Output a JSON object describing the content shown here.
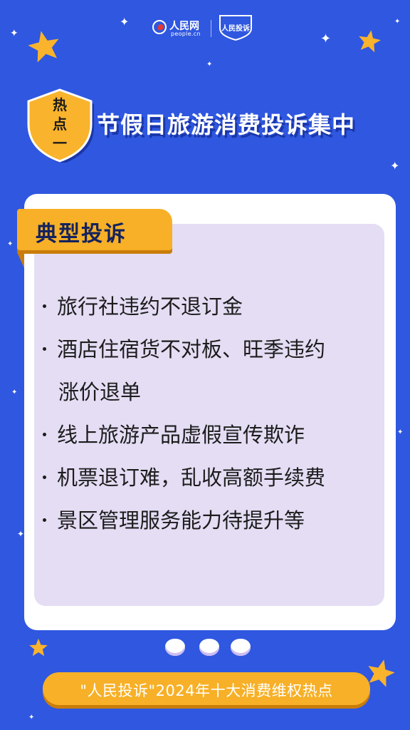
{
  "header": {
    "people_cn": "人民网",
    "people_en": "people.cn",
    "complaint_logo": "人民投诉"
  },
  "badge": {
    "text": "热点一"
  },
  "title": "节假日旅游消费投诉集中",
  "card": {
    "tag": "典型投诉",
    "items": [
      "旅行社违约不退订金",
      "酒店住宿货不对板、旺季违约",
      "涨价退单",
      "线上旅游产品虚假宣传欺诈",
      "机票退订难，乱收高额手续费",
      "景区管理服务能力待提升等"
    ]
  },
  "footer": "\"人民投诉\"2024年十大消费维权热点",
  "colors": {
    "background": "#2f57e0",
    "accent": "#f7b027",
    "card": "#ffffff",
    "card_inner": "#e4ddf4"
  }
}
